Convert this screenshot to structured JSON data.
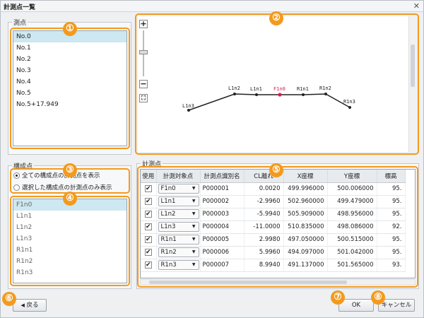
{
  "window": {
    "title": "計測点一覧",
    "close_glyph": "✕"
  },
  "survey_points": {
    "label": "測点",
    "items": [
      "No.0",
      "No.1",
      "No.2",
      "No.3",
      "No.4",
      "No.5",
      "No.5+17.949"
    ],
    "selected_index": 0
  },
  "components": {
    "label": "構成点",
    "radio_all": "全ての構成点の計測点を表示",
    "radio_selected": "選択した構成点の計測点のみ表示",
    "selected_radio": "all",
    "items": [
      "F1n0",
      "L1n1",
      "L1n2",
      "L1n3",
      "R1n1",
      "R1n2",
      "R1n3"
    ],
    "selected_index": 0
  },
  "preview": {
    "zoom_in": "+",
    "zoom_out": "−",
    "fit": "⛶",
    "points": [
      "L1n3",
      "L1n2",
      "L1n1",
      "F1n0",
      "R1n1",
      "R1n2",
      "R1n3"
    ],
    "highlight_point": "F1n0",
    "highlight_color": "#e0194f"
  },
  "measure": {
    "label": "計測点",
    "columns": [
      "使用",
      "計測対象点",
      "計測点識別名",
      "CL離れ",
      "X座標",
      "Y座標",
      "標高"
    ],
    "rows": [
      {
        "use": true,
        "target": "F1n0",
        "id": "P000001",
        "cl": "0.0020",
        "x": "499.996000",
        "y": "500.006000",
        "z": "95."
      },
      {
        "use": true,
        "target": "L1n1",
        "id": "P000002",
        "cl": "-2.9960",
        "x": "502.960000",
        "y": "499.479000",
        "z": "95."
      },
      {
        "use": true,
        "target": "L1n2",
        "id": "P000003",
        "cl": "-5.9940",
        "x": "505.909000",
        "y": "498.956000",
        "z": "95."
      },
      {
        "use": true,
        "target": "L1n3",
        "id": "P000004",
        "cl": "-11.0000",
        "x": "510.835000",
        "y": "498.086000",
        "z": "92."
      },
      {
        "use": true,
        "target": "R1n1",
        "id": "P000005",
        "cl": "2.9980",
        "x": "497.050000",
        "y": "500.515000",
        "z": "95."
      },
      {
        "use": true,
        "target": "R1n2",
        "id": "P000006",
        "cl": "5.9960",
        "x": "494.097000",
        "y": "501.042000",
        "z": "95."
      },
      {
        "use": true,
        "target": "R1n3",
        "id": "P000007",
        "cl": "8.9940",
        "x": "491.137000",
        "y": "501.565000",
        "z": "93."
      }
    ]
  },
  "buttons": {
    "back": "戻る",
    "ok": "OK",
    "cancel": "キャンセル"
  },
  "callouts": [
    "①",
    "②",
    "③",
    "④",
    "⑤",
    "⑥",
    "⑦",
    "⑧"
  ],
  "accent": "#f39a1e"
}
